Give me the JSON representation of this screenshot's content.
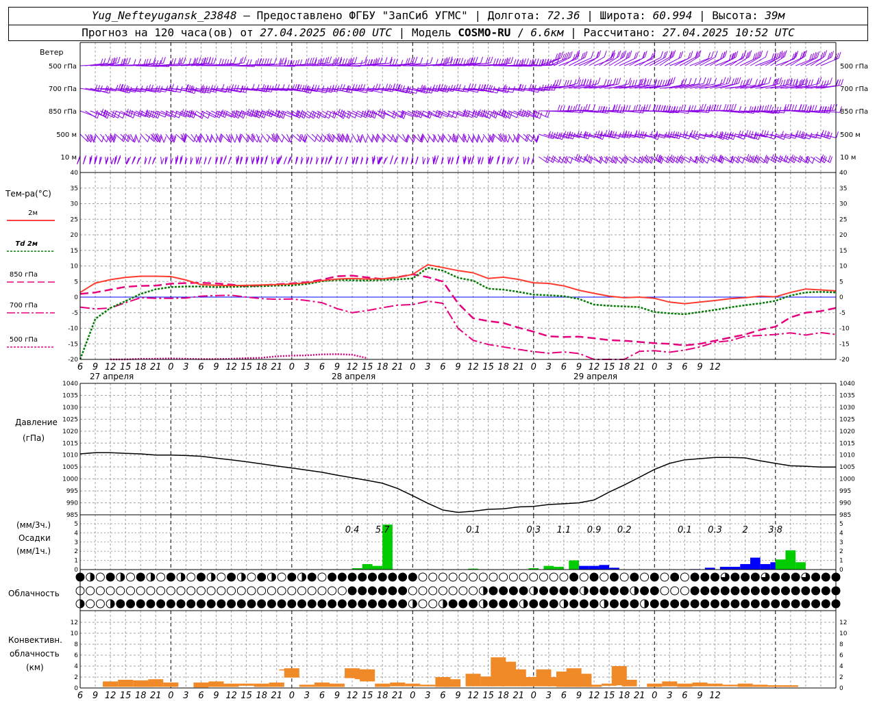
{
  "header": {
    "station": "Yug_Nefteyugansk_23848",
    "dash": "–",
    "provider": "Предоставлено ФГБУ \"ЗапСиб УГМС\"",
    "lon_label": "Долгота:",
    "lon": "72.36",
    "lat_label": "Широта:",
    "lat": "60.994",
    "alt_label": "Высота:",
    "alt": "39м",
    "forecast_prefix": "Прогноз на 120 часа(ов) от",
    "forecast_time": "27.04.2025 06:00 UTC",
    "model_label": "Модель",
    "model_name": "COSMO-RU",
    "model_sep": "/",
    "model_res": "6.6км",
    "calc_label": "Рассчитано:",
    "calc_time": "27.04.2025 10:52 UTC"
  },
  "wind_panel": {
    "title": "Ветер",
    "levels": [
      "500 гПа",
      "700 гПа",
      "850 гПа",
      "500 м",
      "10 м"
    ]
  },
  "temp_panel": {
    "title": "Тем-ра(°C)",
    "legend": [
      {
        "label": "2м",
        "color": "#ff0000",
        "style": "solid"
      },
      {
        "label": "Td 2м",
        "color": "#008000",
        "style": "dotted"
      },
      {
        "label": "850 гПа",
        "color": "#e6007e",
        "style": "dashed"
      },
      {
        "label": "700 гПа",
        "color": "#e6007e",
        "style": "dashdot"
      },
      {
        "label": "500 гПа",
        "color": "#e6007e",
        "style": "dotted"
      }
    ],
    "day_labels": [
      "27 апреля",
      "28 апреля",
      "29 апреля"
    ]
  },
  "pressure_panel": {
    "title_line1": "Давление",
    "title_line2": "(гПа)"
  },
  "precip_panel": {
    "title_line1": "(мм/3ч.)",
    "title_line2": "Осадки",
    "title_line3": "(мм/1ч.)",
    "totals": [
      {
        "hour": 60,
        "text": "0.4"
      },
      {
        "hour": 66,
        "text": "5.7"
      },
      {
        "hour": 84,
        "text": "0.1"
      },
      {
        "hour": 96,
        "text": "0.3"
      },
      {
        "hour": 102,
        "text": "1.1"
      },
      {
        "hour": 108,
        "text": "0.9"
      },
      {
        "hour": 114,
        "text": "0.2"
      },
      {
        "hour": 126,
        "text": "0.1"
      },
      {
        "hour": 132,
        "text": "0.3"
      },
      {
        "hour": 138,
        "text": "2"
      },
      {
        "hour": 144,
        "text": "3.8"
      }
    ]
  },
  "cloud_panel": {
    "title": "Облачность"
  },
  "conv_panel": {
    "title_line1": "Конвективн.",
    "title_line2": "облачность",
    "title_line3": "(км)"
  },
  "colors": {
    "wind": "#8a00e6",
    "grid": "#a0a0a0",
    "t2m": "#ff3b30",
    "td": "#007a00",
    "upper": "#e6007e",
    "rain": "#00cc00",
    "snow": "#0000ff",
    "conv": "#f08a28"
  },
  "chart_data": [
    {
      "type": "line",
      "title": "Тем-ра(°C)",
      "ylim": [
        -20,
        40
      ],
      "yticks": [
        40,
        35,
        30,
        25,
        20,
        15,
        10,
        5,
        0,
        -5,
        -10,
        -15,
        -20
      ],
      "x_hours": [
        6,
        9,
        12,
        15,
        18,
        21,
        24,
        27,
        30,
        33,
        36,
        39,
        42,
        45,
        48,
        51,
        54,
        57,
        60,
        63,
        66,
        69,
        72,
        75,
        78,
        81,
        84,
        87,
        90,
        93,
        96,
        99,
        102,
        105,
        108,
        111,
        114,
        117,
        120,
        123,
        126,
        129,
        132,
        135,
        138,
        141,
        144,
        147,
        150,
        153
      ],
      "xticks": [
        "6",
        "9",
        "12",
        "15",
        "18",
        "21",
        "0",
        "3",
        "6",
        "9",
        "12",
        "15",
        "18",
        "21",
        "0",
        "3",
        "6",
        "9",
        "12",
        "15",
        "18",
        "21",
        "0",
        "3",
        "6",
        "9",
        "12",
        "15",
        "18",
        "21",
        "0",
        "3",
        "6",
        "9",
        "12",
        "15",
        "18",
        "21",
        "0",
        "3",
        "6",
        "9",
        "12"
      ],
      "series": [
        {
          "name": "2м",
          "style": "solid",
          "values": [
            null,
            null,
            null,
            null,
            null,
            null,
            null,
            null,
            null,
            null,
            null,
            null,
            null,
            null,
            null,
            null,
            null,
            null,
            null,
            null,
            null,
            null,
            null,
            null,
            null,
            null,
            null,
            null,
            null,
            null,
            null,
            null,
            null,
            null,
            null,
            null,
            null,
            null,
            null,
            null,
            null,
            null,
            null,
            null,
            null,
            null,
            null,
            null,
            null,
            null
          ]
        },
        {
          "name": "Td 2м",
          "style": "dotted",
          "values": []
        },
        {
          "name": "850 гПа",
          "style": "dashed",
          "values": []
        },
        {
          "name": "700 гПа",
          "style": "dashdot",
          "values": []
        },
        {
          "name": "500 гПа",
          "style": "dotted",
          "values": []
        }
      ]
    },
    {
      "type": "line",
      "title": "Давление",
      "ylabel": "(гПа)",
      "ylim": [
        985,
        1040
      ],
      "yticks": [
        1040,
        1035,
        1030,
        1025,
        1020,
        1015,
        1010,
        1005,
        1000,
        995,
        990,
        985
      ]
    },
    {
      "type": "bar",
      "title": "Осадки",
      "ylim": [
        0,
        5
      ],
      "yticks": [
        5,
        4,
        3,
        2,
        1,
        0
      ]
    },
    {
      "type": "bar",
      "title": "Конвективн. облачность",
      "ylabel": "(км)",
      "ylim": [
        0,
        13
      ],
      "yticks": [
        12,
        10,
        8,
        6,
        4,
        2,
        0
      ]
    }
  ]
}
